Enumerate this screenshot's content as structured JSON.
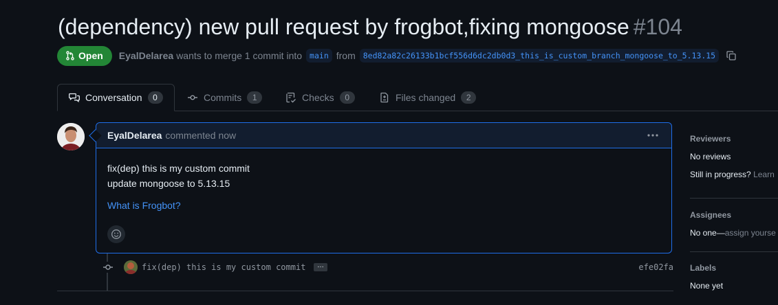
{
  "pr": {
    "title": "(dependency) new pull request by frogbot,fixing mongoose",
    "number": "#104",
    "state": "Open",
    "author": "EyalDelarea",
    "merge_text": "wants to merge 1 commit into",
    "base_branch": "main",
    "from_text": "from",
    "head_branch": "8ed82a82c26133b1bcf556d6dc2db0d3_this_is_custom_branch_mongoose_to_5.13.15"
  },
  "tabs": [
    {
      "label": "Conversation",
      "count": "0",
      "icon": "comment-discussion-icon"
    },
    {
      "label": "Commits",
      "count": "1",
      "icon": "git-commit-icon"
    },
    {
      "label": "Checks",
      "count": "0",
      "icon": "checklist-icon"
    },
    {
      "label": "Files changed",
      "count": "2",
      "icon": "file-diff-icon"
    }
  ],
  "comment": {
    "author": "EyalDelarea",
    "time": "commented now",
    "line1": "fix(dep) this is my custom commit",
    "line2": "update mongoose to 5.13.15",
    "link": "What is Frogbot?"
  },
  "commit": {
    "message": "fix(dep) this is my custom commit",
    "ellipsis": "…",
    "sha": "efe02fa"
  },
  "sidebar": {
    "reviewers_heading": "Reviewers",
    "reviewers_value": "No reviews",
    "still_in_progress": "Still in progress?",
    "learn": "Learn",
    "assignees_heading": "Assignees",
    "assignees_value": "No one—",
    "assign_yourself": "assign yourse",
    "labels_heading": "Labels",
    "labels_value": "None yet"
  },
  "colors": {
    "background": "#0d1117",
    "open_green": "#238636",
    "link_blue": "#4493f8",
    "border": "#30363d",
    "accent_border": "#1f6feb"
  }
}
